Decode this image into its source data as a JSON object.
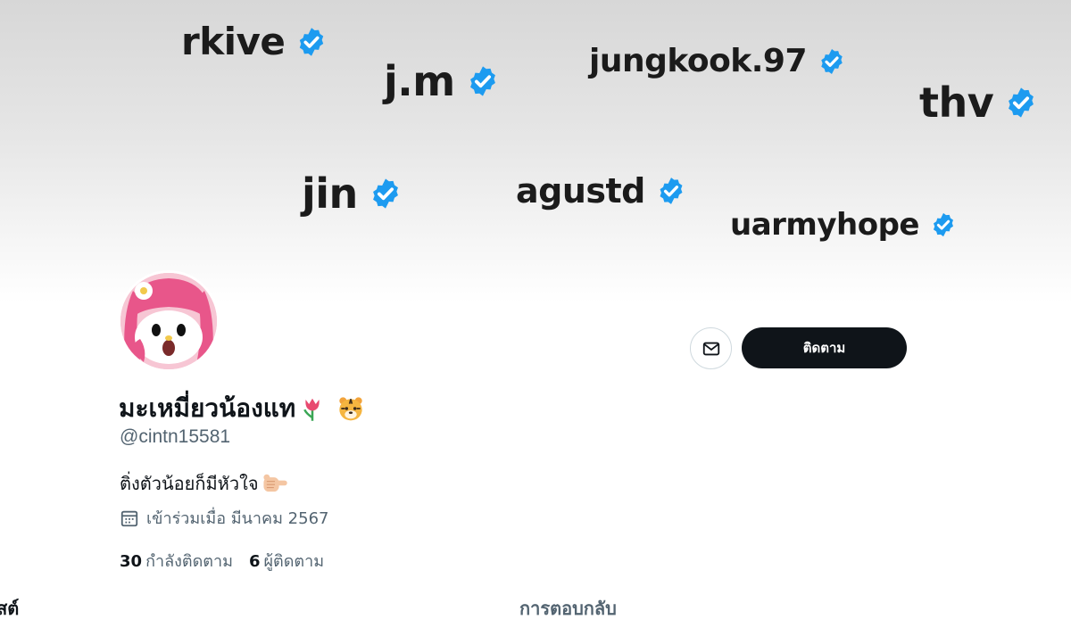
{
  "banner": {
    "handles": [
      {
        "name": "rkive"
      },
      {
        "name": "j.m"
      },
      {
        "name": "jungkook.97"
      },
      {
        "name": "thv"
      },
      {
        "name": "jin"
      },
      {
        "name": "agustd"
      },
      {
        "name": "uarmyhope"
      }
    ],
    "badge_color": "#1d9bf0"
  },
  "profile": {
    "display_name": "มะเหมี่ยวน้องแท",
    "display_name_emojis": [
      "tulip-emoji",
      "tiger-face-emoji"
    ],
    "username": "@cintn15581",
    "bio": "ติ่งตัวน้อยก็มีหัวใจ",
    "bio_emoji": "pointing-hand-emoji",
    "joined": "เข้าร่วมเมื่อ มีนาคม 2567",
    "following_count": "30",
    "following_label": "กำลังติดตาม",
    "followers_count": "6",
    "followers_label": "ผู้ติดตาม"
  },
  "actions": {
    "follow_label": "ติดตาม",
    "message_icon": "envelope-icon"
  },
  "tabs": {
    "posts_label": "สต์",
    "replies_label": "การตอบกลับ"
  },
  "colors": {
    "primary_text": "#0f1419",
    "secondary_text": "#536471",
    "follow_button": "#0f1419",
    "verified": "#1d9bf0"
  }
}
